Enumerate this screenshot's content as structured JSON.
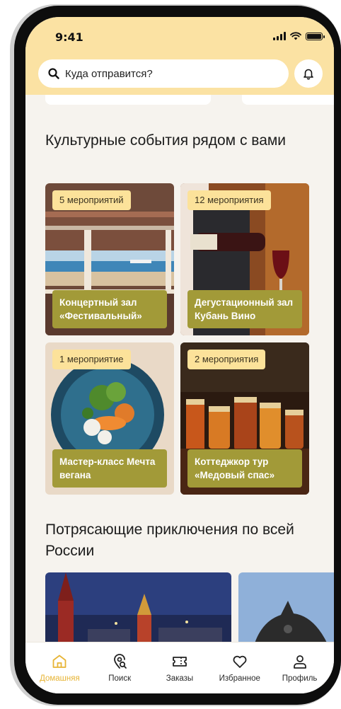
{
  "status_bar": {
    "time": "9:41"
  },
  "search": {
    "placeholder": "Куда отправится?"
  },
  "sections": {
    "cultural": {
      "title": "Культурные события рядом с вами",
      "cards": [
        {
          "badge": "5 мероприятий",
          "label": "Концертный зал «Фестивальный»"
        },
        {
          "badge": "12 мероприятия",
          "label": "Дегустационный зал Кубань Вино"
        },
        {
          "badge": "1 мероприятие",
          "label": "Мастер-класс Мечта вегана"
        },
        {
          "badge": "2 мероприятия",
          "label": "Коттеджкор тур «Медовый спас»"
        }
      ]
    },
    "adventures": {
      "title": "Потрясающие приключения по всей России"
    }
  },
  "tabs": [
    {
      "label": "Домашняя",
      "icon": "home-icon",
      "active": true
    },
    {
      "label": "Поиск",
      "icon": "map-search-icon",
      "active": false
    },
    {
      "label": "Заказы",
      "icon": "ticket-icon",
      "active": false
    },
    {
      "label": "Избранное",
      "icon": "heart-icon",
      "active": false
    },
    {
      "label": "Профиль",
      "icon": "profile-icon",
      "active": false
    }
  ],
  "colors": {
    "header_bg": "#fbe2a3",
    "badge_bg": "#fce29a",
    "card_label_bg": "#a29a38",
    "active_tab": "#e7b435",
    "page_bg": "#f6f3ee"
  }
}
